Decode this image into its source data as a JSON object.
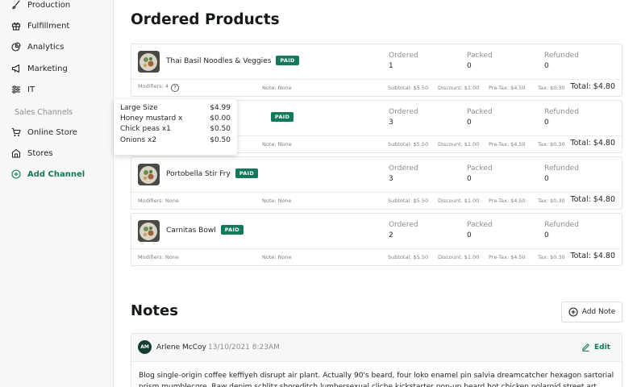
{
  "sidebar": {
    "items": [
      {
        "label": "Production",
        "icon": "brush-icon"
      },
      {
        "label": "Fulfillment",
        "icon": "gift-icon"
      },
      {
        "label": "Analytics",
        "icon": "pie-chart-icon"
      },
      {
        "label": "Marketing",
        "icon": "megaphone-icon"
      },
      {
        "label": "IT",
        "icon": "sliders-icon"
      }
    ],
    "section_label": "Sales Channels",
    "channels": [
      {
        "label": "Online Store",
        "icon": "cart-icon"
      },
      {
        "label": "Stores",
        "icon": "store-icon"
      }
    ],
    "add_channel_label": "Add Channel"
  },
  "ordered_products": {
    "title": "Ordered Products",
    "labels": {
      "ordered": "Ordered",
      "packed": "Packed",
      "refunded": "Refunded",
      "paid_badge": "PAID"
    },
    "products": [
      {
        "name": "Thai Basil Noodles & Veggies",
        "ordered": "1",
        "packed": "0",
        "refunded": "0",
        "modifiers": "Modifiers: 4",
        "note": "Note: None",
        "subtotal": "Subtotal: $5.50",
        "discount": "Discount: $1.00",
        "pretax": "Pre-Tax: $4.50",
        "tax": "Tax: $0.30",
        "total": "Total: $4.80"
      },
      {
        "name": "",
        "ordered": "3",
        "packed": "0",
        "refunded": "0",
        "modifiers": "",
        "note": "Note: None",
        "subtotal": "Subtotal: $5.50",
        "discount": "Discount: $1.00",
        "pretax": "Pre-Tax: $4.50",
        "tax": "Tax: $0.30",
        "total": "Total: $4.80"
      },
      {
        "name": "Portobella Stir Fry",
        "ordered": "3",
        "packed": "0",
        "refunded": "0",
        "modifiers": "Modifiers: None",
        "note": "Note: None",
        "subtotal": "Subtotal: $5.50",
        "discount": "Discount: $1.00",
        "pretax": "Pre-Tax: $4.50",
        "tax": "Tax: $0.30",
        "total": "Total: $4.80"
      },
      {
        "name": "Carnitas Bowl",
        "ordered": "2",
        "packed": "0",
        "refunded": "0",
        "modifiers": "Modifiers: None",
        "note": "Note: None",
        "subtotal": "Subtotal: $5.50",
        "discount": "Discount: $1.00",
        "pretax": "Pre-Tax: $4.50",
        "tax": "Tax: $0.30",
        "total": "Total: $4.80"
      }
    ]
  },
  "tooltip": {
    "rows": [
      {
        "name": "Large Size",
        "price": "$4.99"
      },
      {
        "name": "Honey mustard x",
        "price": "$0.00"
      },
      {
        "name": "Chick peas x1",
        "price": "$0.50"
      },
      {
        "name": "Onions x2",
        "price": "$0.50"
      }
    ]
  },
  "notes": {
    "title": "Notes",
    "add_label": "Add Note",
    "entry": {
      "initials": "AM",
      "author": "Arlene McCoy",
      "date": "13/10/2021 8:23AM",
      "edit_label": "Edit",
      "body": "Blog single-origin coffee keffiyeh disrupt air plant. Actually 90's beard, four loko enamel pin salvia dreamcatcher hexagon sartorial prism mumblecore. Raw denim schlitz shoreditch lumbersexual cliche kickstarter pop-up beard hot chicken polaroid street art prism"
    }
  },
  "colors": {
    "accent": "#0f7a5a",
    "badge": "#127a5b",
    "avatar": "#163d34"
  }
}
